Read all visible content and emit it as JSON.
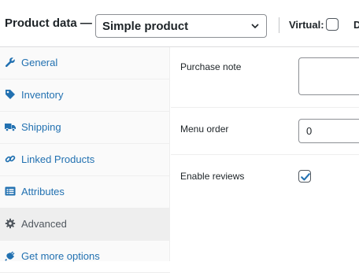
{
  "header": {
    "title": "Product data —",
    "product_type": "Simple product",
    "virtual_label": "Virtual:",
    "virtual_checked": false,
    "downloadable_label": "D"
  },
  "tabs": [
    {
      "label": "General",
      "icon": "wrench-icon",
      "active": false
    },
    {
      "label": "Inventory",
      "icon": "tag-icon",
      "active": false
    },
    {
      "label": "Shipping",
      "icon": "truck-icon",
      "active": false
    },
    {
      "label": "Linked Products",
      "icon": "link-icon",
      "active": false
    },
    {
      "label": "Attributes",
      "icon": "list-icon",
      "active": false
    },
    {
      "label": "Advanced",
      "icon": "gear-icon",
      "active": true
    },
    {
      "label": "Get more options",
      "icon": "plugin-icon",
      "active": false
    }
  ],
  "advanced": {
    "purchase_note_label": "Purchase note",
    "purchase_note_value": "",
    "menu_order_label": "Menu order",
    "menu_order_value": "0",
    "enable_reviews_label": "Enable reviews",
    "enable_reviews_checked": true
  },
  "colors": {
    "link": "#2271b1",
    "active_tab_bg": "#eeeeee",
    "sidebar_bg": "#fafafa",
    "text": "#1d2327"
  }
}
